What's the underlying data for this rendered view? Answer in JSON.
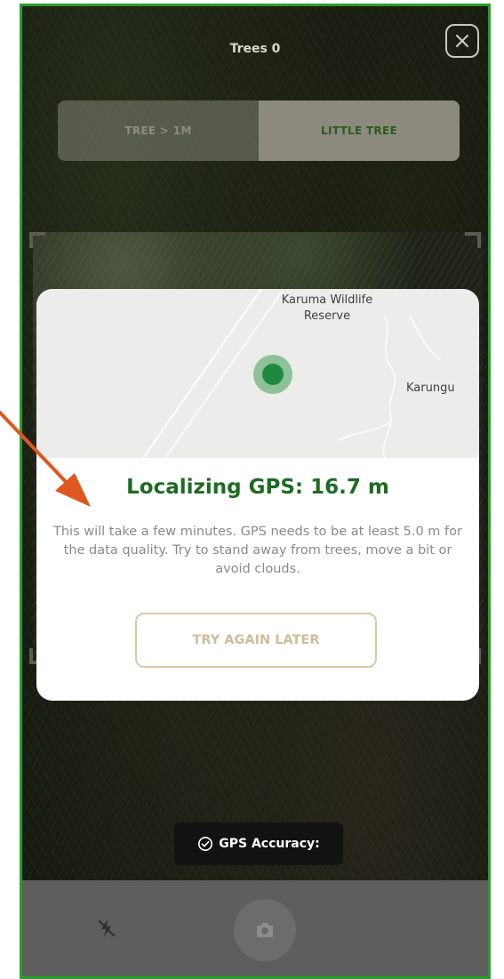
{
  "header": {
    "title": "Trees 0",
    "close_icon": "close-icon"
  },
  "tabs": [
    {
      "label": "TREE > 1M",
      "active": false
    },
    {
      "label": "LITTLE TREE",
      "active": true
    }
  ],
  "modal": {
    "map": {
      "place_reserve": "Karuma Wildlife Reserve",
      "place_town": "Karungu"
    },
    "heading": "Localizing GPS: 16.7 m",
    "body": "This will take a few minutes. GPS needs to be at least 5.0 m for the data quality. Try to stand away from trees, move a bit or avoid clouds.",
    "button_label": "TRY AGAIN LATER"
  },
  "gps_badge": {
    "icon": "check-circle-icon",
    "label": "GPS Accuracy:"
  },
  "bottom_bar": {
    "flash_icon": "flash-off-icon",
    "shutter_icon": "camera-icon"
  },
  "colors": {
    "accent_green": "#1d6b22",
    "frame_border": "#2a9d2a",
    "annotation_arrow": "#e0561f",
    "button_border": "#d9c8a8"
  }
}
